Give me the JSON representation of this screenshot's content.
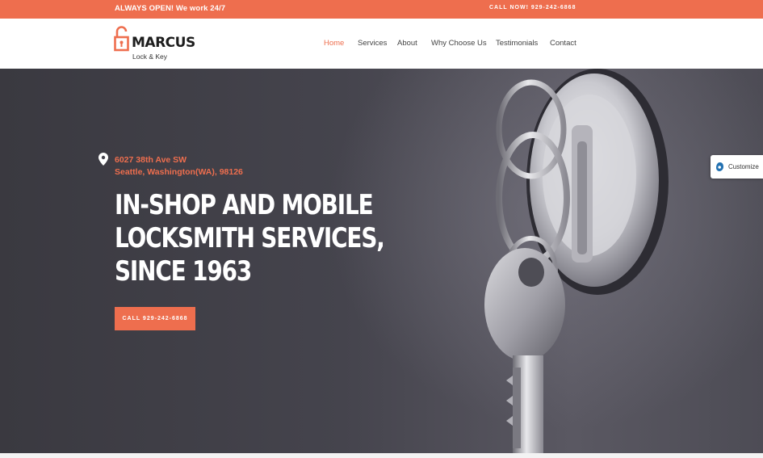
{
  "topbar": {
    "left_text": "ALWAYS OPEN! We work 24/7",
    "call_text": "CALL NOW! 929-242-6868"
  },
  "logo": {
    "name": "MARCUS",
    "subtitle": "Lock & Key",
    "icon": "padlock-icon"
  },
  "nav": {
    "items": [
      {
        "label": "Home",
        "active": true
      },
      {
        "label": "Services",
        "active": false
      },
      {
        "label": "About",
        "active": false
      },
      {
        "label": "Why Choose Us",
        "active": false
      },
      {
        "label": "Testimonials",
        "active": false
      },
      {
        "label": "Contact",
        "active": false
      }
    ]
  },
  "hero": {
    "address_line1": "6027 38th Ave SW",
    "address_line2": "Seattle, Washington(WA), 98126",
    "address_icon": "map-pin-icon",
    "headline_line1": "IN-SHOP AND MOBILE",
    "headline_line2": "LOCKSMITH SERVICES,",
    "headline_line3": "SINCE 1963",
    "cta_label": "CALL 929-242-6868"
  },
  "customize": {
    "label": "Customize",
    "icon": "customize-icon"
  },
  "colors": {
    "accent": "#ee6e4e",
    "hero_bg": "#45444d",
    "text_dark": "#1d1d1d"
  }
}
